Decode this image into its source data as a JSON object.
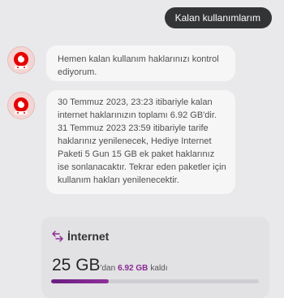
{
  "user_message": "Kalan kullanımlarım",
  "bot_messages": [
    "Hemen kalan kullanım haklarınızı kontrol ediyorum.",
    "30 Temmuz 2023, 23:23 itibariyle kalan internet haklarınızın toplamı 6.92 GB'dir. 31 Temmuz 2023 23:59 itibariyle tarife haklarınız yenilenecek, Hediye Internet Paketi 5 Gun 15 GB ek paket haklarınız ise sonlanacaktır. Tekrar eden paketler için kullanım hakları yenilenecektir."
  ],
  "usage_card": {
    "icon": "data-transfer-icon",
    "title": "İnternet",
    "total": "25 GB",
    "from_word": "'dan",
    "remaining": "6.92 GB",
    "remaining_word": "kaldı",
    "progress_fraction": 0.277,
    "accent_color": "#8a2b93"
  },
  "colors": {
    "brand_red": "#e60000",
    "user_bubble": "#333436",
    "bot_bubble": "#f6f6f7"
  }
}
